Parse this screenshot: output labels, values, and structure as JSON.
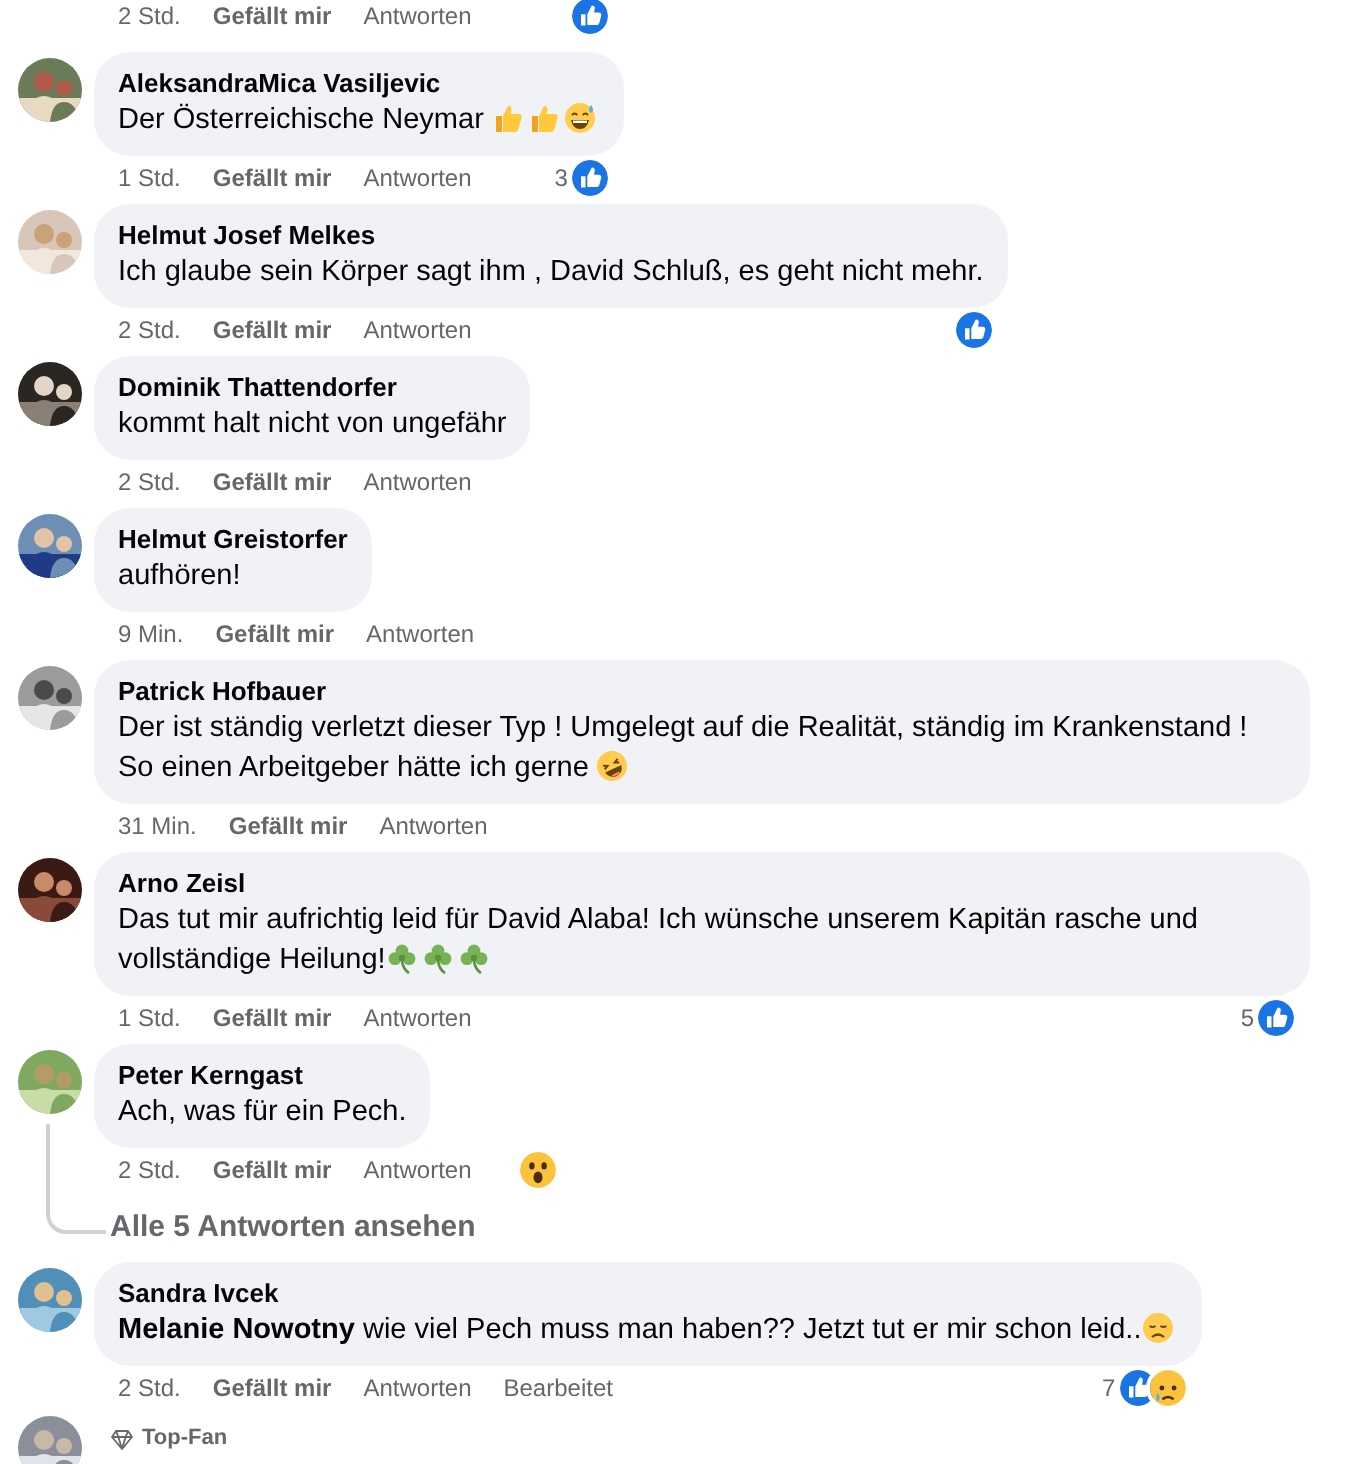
{
  "comments": [
    {
      "kind": "cut_top",
      "time": "2 Std.",
      "like_label": "Gefällt mir",
      "reply_label": "Antworten",
      "reactions": {
        "icons": [
          {
            "kind": "like"
          }
        ]
      }
    },
    {
      "kind": "comment",
      "author": "AleksandraMica Vasiljevic",
      "text": "Der Österreichische Neymar ",
      "emojis": [
        {
          "kind": "thumbs_up"
        },
        {
          "kind": "thumbs_up"
        },
        {
          "kind": "grin_sweat"
        }
      ],
      "time": "1 Std.",
      "like_label": "Gefällt mir",
      "reply_label": "Antworten",
      "reactions": {
        "count": "3",
        "icons": [
          {
            "kind": "like"
          }
        ]
      }
    },
    {
      "kind": "comment",
      "author": "Helmut Josef Melkes",
      "text": "Ich glaube sein Körper sagt ihm , David Schluß, es geht nicht mehr.",
      "time": "2 Std.",
      "like_label": "Gefällt mir",
      "reply_label": "Antworten",
      "reactions": {
        "icons": [
          {
            "kind": "like"
          }
        ]
      }
    },
    {
      "kind": "comment",
      "author": "Dominik Thattendorfer",
      "text": "kommt halt nicht von ungefähr",
      "time": "2 Std.",
      "like_label": "Gefällt mir",
      "reply_label": "Antworten"
    },
    {
      "kind": "comment",
      "author": "Helmut Greistorfer",
      "text": "aufhören!",
      "time": "9 Min.",
      "like_label": "Gefällt mir",
      "reply_label": "Antworten"
    },
    {
      "kind": "comment",
      "author": "Patrick Hofbauer",
      "text": "Der ist ständig verletzt dieser Typ ! Umgelegt auf die Realität, ständig im Krankenstand ! So einen Arbeitgeber hätte ich gerne ",
      "emojis": [
        {
          "kind": "rofl"
        }
      ],
      "time": "31 Min.",
      "like_label": "Gefällt mir",
      "reply_label": "Antworten"
    },
    {
      "kind": "comment",
      "author": "Arno Zeisl",
      "text": "Das tut mir aufrichtig leid für David Alaba! Ich wünsche unserem Kapitän rasche und vollständige Heilung!",
      "emojis": [
        {
          "kind": "clover"
        },
        {
          "kind": "clover"
        },
        {
          "kind": "clover"
        }
      ],
      "time": "1 Std.",
      "like_label": "Gefällt mir",
      "reply_label": "Antworten",
      "reactions": {
        "count": "5",
        "icons": [
          {
            "kind": "like"
          }
        ]
      }
    },
    {
      "kind": "comment",
      "author": "Peter Kerngast",
      "text": "Ach, was für ein Pech.",
      "time": "2 Std.",
      "like_label": "Gefällt mir",
      "reply_label": "Antworten",
      "reactions": {
        "icons": [
          {
            "kind": "wow"
          }
        ]
      },
      "replies_link": "Alle 5 Antworten ansehen"
    },
    {
      "kind": "comment",
      "author": "Sandra Ivcek",
      "text": "**Melanie Nowotny** wie viel Pech muss man haben?? Jetzt tut er mir schon leid..",
      "emojis": [
        {
          "kind": "disappointed"
        }
      ],
      "time": "2 Std.",
      "like_label": "Gefällt mir",
      "reply_label": "Antworten",
      "edited": "Bearbeitet",
      "reactions": {
        "count": "7",
        "icons": [
          {
            "kind": "like"
          },
          {
            "kind": "sad"
          }
        ]
      }
    },
    {
      "kind": "cut_bottom",
      "badge": "Top-Fan"
    }
  ]
}
